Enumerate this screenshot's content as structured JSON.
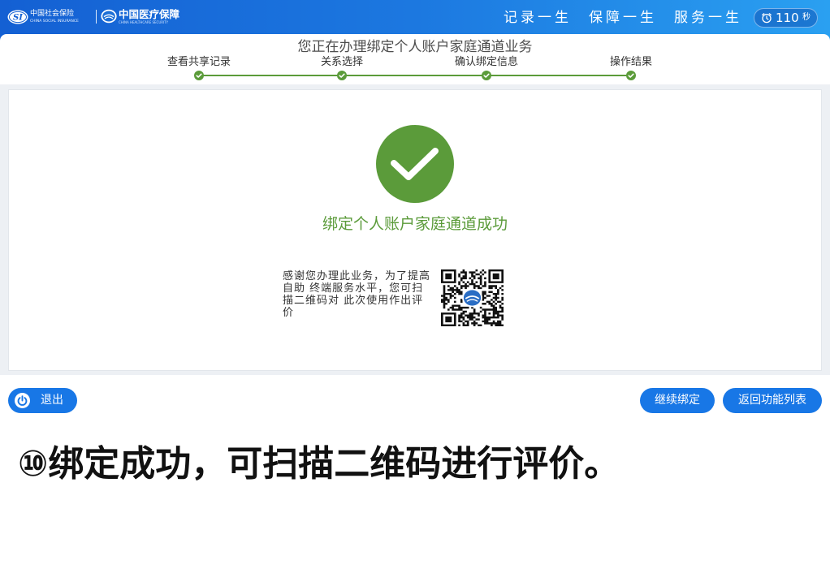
{
  "header": {
    "logo_social": {
      "mark": "SI",
      "name_cn": "中国社会保险",
      "name_en": "CHINA SOCIAL INSURANCE",
      "icon": "social-insurance-logo"
    },
    "logo_healthcare": {
      "name_cn": "中国医疗保障",
      "name_en": "CHINA HEALTHCARE SECURITY",
      "icon": "healthcare-security-logo"
    },
    "slogans": [
      "记录一生",
      "保障一生",
      "服务一生"
    ],
    "timer": {
      "value": "110",
      "unit": "秒",
      "icon": "alarm-clock-icon"
    }
  },
  "page_title": "您正在办理绑定个人账户家庭通道业务",
  "steps": [
    {
      "label": "查看共享记录",
      "completed": true,
      "icon": "check-icon"
    },
    {
      "label": "关系选择",
      "completed": true,
      "icon": "check-icon"
    },
    {
      "label": "确认绑定信息",
      "completed": true,
      "icon": "check-icon"
    },
    {
      "label": "操作结果",
      "completed": true,
      "icon": "check-icon"
    }
  ],
  "result": {
    "status_icon": "success-check-icon",
    "message": "绑定个人账户家庭通道成功",
    "thanks_lines": [
      "感谢您办理此业务，为了提高",
      "自助 终端服务水平，您可扫",
      "描二维码对 此次使用作出评",
      "价"
    ],
    "qr_icon": "qr-code"
  },
  "footer": {
    "exit": {
      "label": "退出",
      "icon": "power-icon"
    },
    "continue": {
      "label": "继续绑定"
    },
    "back": {
      "label": "返回功能列表"
    }
  },
  "caption": "⑩绑定成功，可扫描二维码进行评价。",
  "colors": {
    "header_gradient_start": "#1460d3",
    "header_gradient_end": "#2aa0f1",
    "button": "#1877e6",
    "success": "#5b9b3a",
    "panel_background": "#edf0f4"
  }
}
